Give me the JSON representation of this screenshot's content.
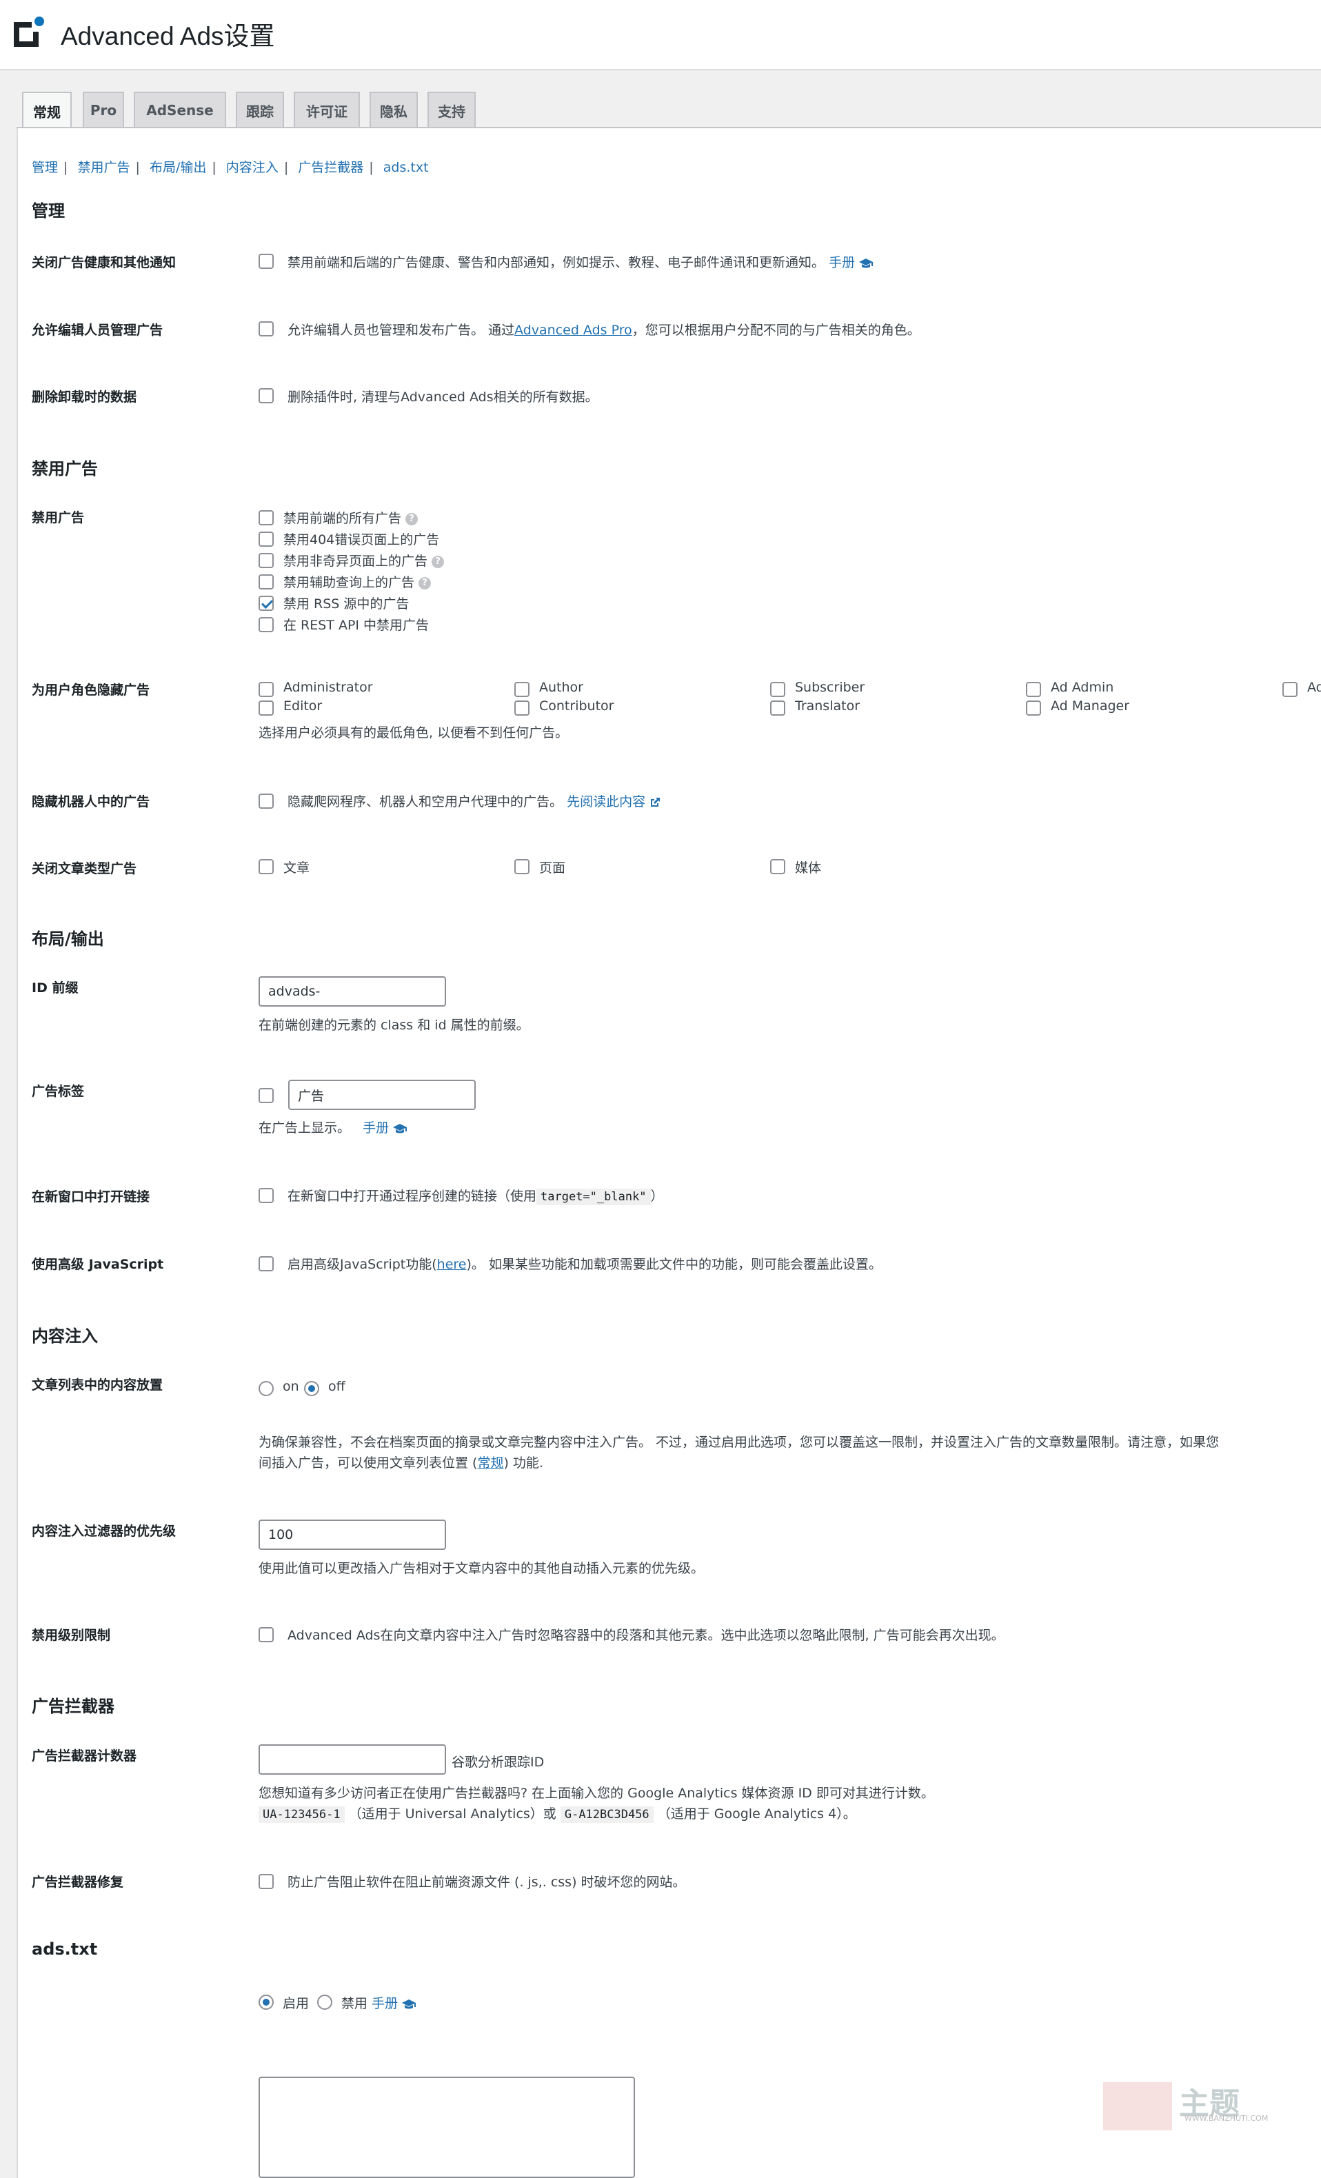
{
  "header": {
    "title": "Advanced Ads设置"
  },
  "tabs": [
    {
      "label": "常规",
      "active": true
    },
    {
      "label": "Pro"
    },
    {
      "label": "AdSense"
    },
    {
      "label": "跟踪"
    },
    {
      "label": "许可证"
    },
    {
      "label": "隐私"
    },
    {
      "label": "支持"
    }
  ],
  "subnav": [
    "管理",
    "禁用广告",
    "布局/输出",
    "内容注入",
    "广告拦截器",
    "ads.txt"
  ],
  "sections": {
    "admin": "管理",
    "disable": "禁用广告",
    "layout": "布局/输出",
    "injection": "内容注入",
    "adblock": "广告拦截器",
    "adstxt": "ads.txt"
  },
  "admin": {
    "notices_label": "关闭广告健康和其他通知",
    "notices_text": "禁用前端和后端的广告健康、警告和内部通知，例如提示、教程、电子邮件通讯和更新通知。",
    "manual": "手册",
    "editors_label": "允许编辑人员管理广告",
    "editors_text_1": "允许编辑人员也管理和发布广告。 通过",
    "editors_link": "Advanced Ads Pro",
    "editors_text_2": "，您可以根据用户分配不同的与广告相关的角色。",
    "uninstall_label": "删除卸载时的数据",
    "uninstall_text": "删除插件时, 清理与Advanced Ads相关的所有数据。"
  },
  "disable": {
    "label": "禁用广告",
    "options": [
      {
        "text": "禁用前端的所有广告",
        "checked": false,
        "help": true
      },
      {
        "text": "禁用404错误页面上的广告",
        "checked": false,
        "help": false
      },
      {
        "text": "禁用非奇异页面上的广告",
        "checked": false,
        "help": true
      },
      {
        "text": "禁用辅助查询上的广告",
        "checked": false,
        "help": true
      },
      {
        "text": "禁用 RSS 源中的广告",
        "checked": true,
        "help": false
      },
      {
        "text": "在 REST API 中禁用广告",
        "checked": false,
        "help": false
      }
    ],
    "roles_label": "为用户角色隐藏广告",
    "roles": [
      [
        "Administrator",
        "Editor"
      ],
      [
        "Author",
        "Contributor"
      ],
      [
        "Subscriber",
        "Translator"
      ],
      [
        "Ad Admin",
        "Ad Manager"
      ],
      [
        "Ad User"
      ]
    ],
    "roles_desc": "选择用户必须具有的最低角色, 以便看不到任何广告。",
    "bots_label": "隐藏机器人中的广告",
    "bots_text": "隐藏爬网程序、机器人和空用户代理中的广告。",
    "bots_link": "先阅读此内容",
    "posttypes_label": "关闭文章类型广告",
    "posttypes": [
      "文章",
      "页面",
      "媒体"
    ]
  },
  "layout": {
    "prefix_label": "ID 前缀",
    "prefix_value": "advads-",
    "prefix_desc": "在前端创建的元素的 class 和 id 属性的前缀。",
    "adlabel_label": "广告标签",
    "adlabel_value": "广告",
    "adlabel_desc": "在广告上显示。",
    "manual": "手册",
    "newwin_label": "在新窗口中打开链接",
    "newwin_text": "在新窗口中打开通过程序创建的链接（使用",
    "newwin_code": "target=\"_blank\"",
    "newwin_end": "）",
    "js_label": "使用高级 JavaScript",
    "js_text_1": "启用高级JavaScript功能(",
    "js_link": "here",
    "js_text_2": ")。 如果某些功能和加载项需要此文件中的功能，则可能会覆盖此设置。"
  },
  "injection": {
    "archive_label": "文章列表中的内容放置",
    "on": "on",
    "off": "off",
    "archive_desc_1": "为确保兼容性，不会在档案页面的摘录或文章完整内容中注入广告。 不过，通过启用此选项，您可以覆盖这一限制，并设置注入广告的文章数量限制。请注意，如果您",
    "archive_desc_2a": "间插入广告，可以使用文章列表位置 (",
    "archive_desc_link": "常规",
    "archive_desc_2b": ") 功能.",
    "priority_label": "内容注入过滤器的优先级",
    "priority_value": "100",
    "priority_desc": "使用此值可以更改插入广告相对于文章内容中的其他自动插入元素的优先级。",
    "level_label": "禁用级别限制",
    "level_text": "Advanced Ads在向文章内容中注入广告时忽略容器中的段落和其他元素。选中此选项以忽略此限制, 广告可能会再次出现。"
  },
  "adblock": {
    "counter_label": "广告拦截器计数器",
    "counter_suffix": "谷歌分析跟踪ID",
    "counter_desc": "您想知道有多少访问者正在使用广告拦截器吗? 在上面输入您的 Google Analytics 媒体资源 ID 即可对其进行计数。",
    "ua_code": "UA-123456-1",
    "ua_text": "（适用于 Universal Analytics）或",
    "g_code": "G-A12BC3D456",
    "g_text": "（适用于 Google Analytics 4）。",
    "fix_label": "广告拦截器修复",
    "fix_text": "防止广告阻止软件在阻止前端资源文件 (. js,. css) 时破坏您的网站。"
  },
  "adstxt": {
    "enable": "启用",
    "disable": "禁用",
    "manual": "手册"
  },
  "watermark": {
    "text": "主题",
    "url": "WWW.BANZHUTI.COM"
  },
  "colors": {
    "link": "#2271b1",
    "text": "#3c434a",
    "bg": "#f0f0f1"
  }
}
